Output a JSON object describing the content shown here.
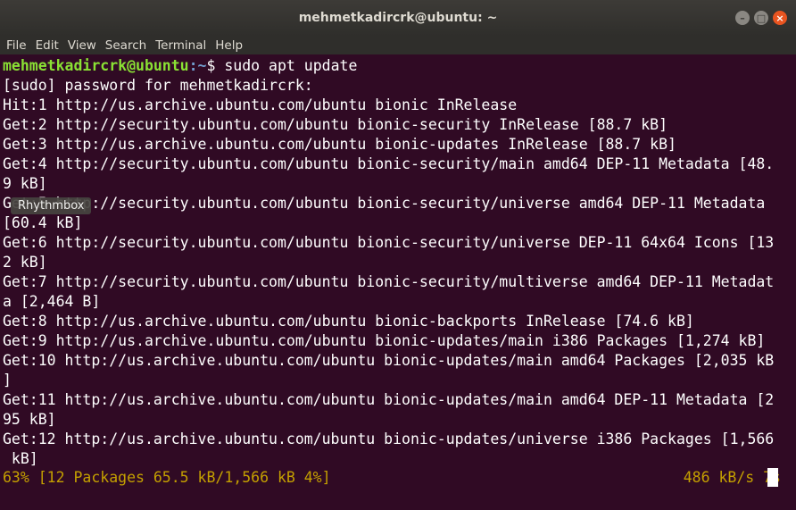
{
  "window": {
    "title": "mehmetkadircrk@ubuntu: ~"
  },
  "window_buttons": {
    "minimize": "–",
    "maximize": "□",
    "close": "×"
  },
  "menu": [
    "File",
    "Edit",
    "View",
    "Search",
    "Terminal",
    "Help"
  ],
  "prompt": {
    "user": "mehmetkadircrk@ubuntu",
    "path": ":~",
    "symbol": "$ ",
    "command": "sudo apt update"
  },
  "lines": [
    "[sudo] password for mehmetkadircrk:",
    "Hit:1 http://us.archive.ubuntu.com/ubuntu bionic InRelease",
    "Get:2 http://security.ubuntu.com/ubuntu bionic-security InRelease [88.7 kB]",
    "Get:3 http://us.archive.ubuntu.com/ubuntu bionic-updates InRelease [88.7 kB]",
    "Get:4 http://security.ubuntu.com/ubuntu bionic-security/main amd64 DEP-11 Metadata [48.",
    "9 kB]",
    "Get:5 http://security.ubuntu.com/ubuntu bionic-security/universe amd64 DEP-11 Metadata",
    "[60.4 kB]",
    "Get:6 http://security.ubuntu.com/ubuntu bionic-security/universe DEP-11 64x64 Icons [13",
    "2 kB]",
    "Get:7 http://security.ubuntu.com/ubuntu bionic-security/multiverse amd64 DEP-11 Metadat",
    "a [2,464 B]",
    "Get:8 http://us.archive.ubuntu.com/ubuntu bionic-backports InRelease [74.6 kB]",
    "Get:9 http://us.archive.ubuntu.com/ubuntu bionic-updates/main i386 Packages [1,274 kB]",
    "Get:10 http://us.archive.ubuntu.com/ubuntu bionic-updates/main amd64 Packages [2,035 kB",
    "]",
    "Get:11 http://us.archive.ubuntu.com/ubuntu bionic-updates/main amd64 DEP-11 Metadata [2",
    "95 kB]",
    "Get:12 http://us.archive.ubuntu.com/ubuntu bionic-updates/universe i386 Packages [1,566",
    " kB]"
  ],
  "progress": {
    "left": "63% [12 Packages 65.5 kB/1,566 kB 4%]",
    "right": "486 kB/s 7s"
  },
  "tooltip": "Rhythmbox",
  "colors": {
    "background": "#300a24",
    "prompt_user": "#8ae234",
    "prompt_path": "#729fcf",
    "progress": "#c4a000"
  }
}
